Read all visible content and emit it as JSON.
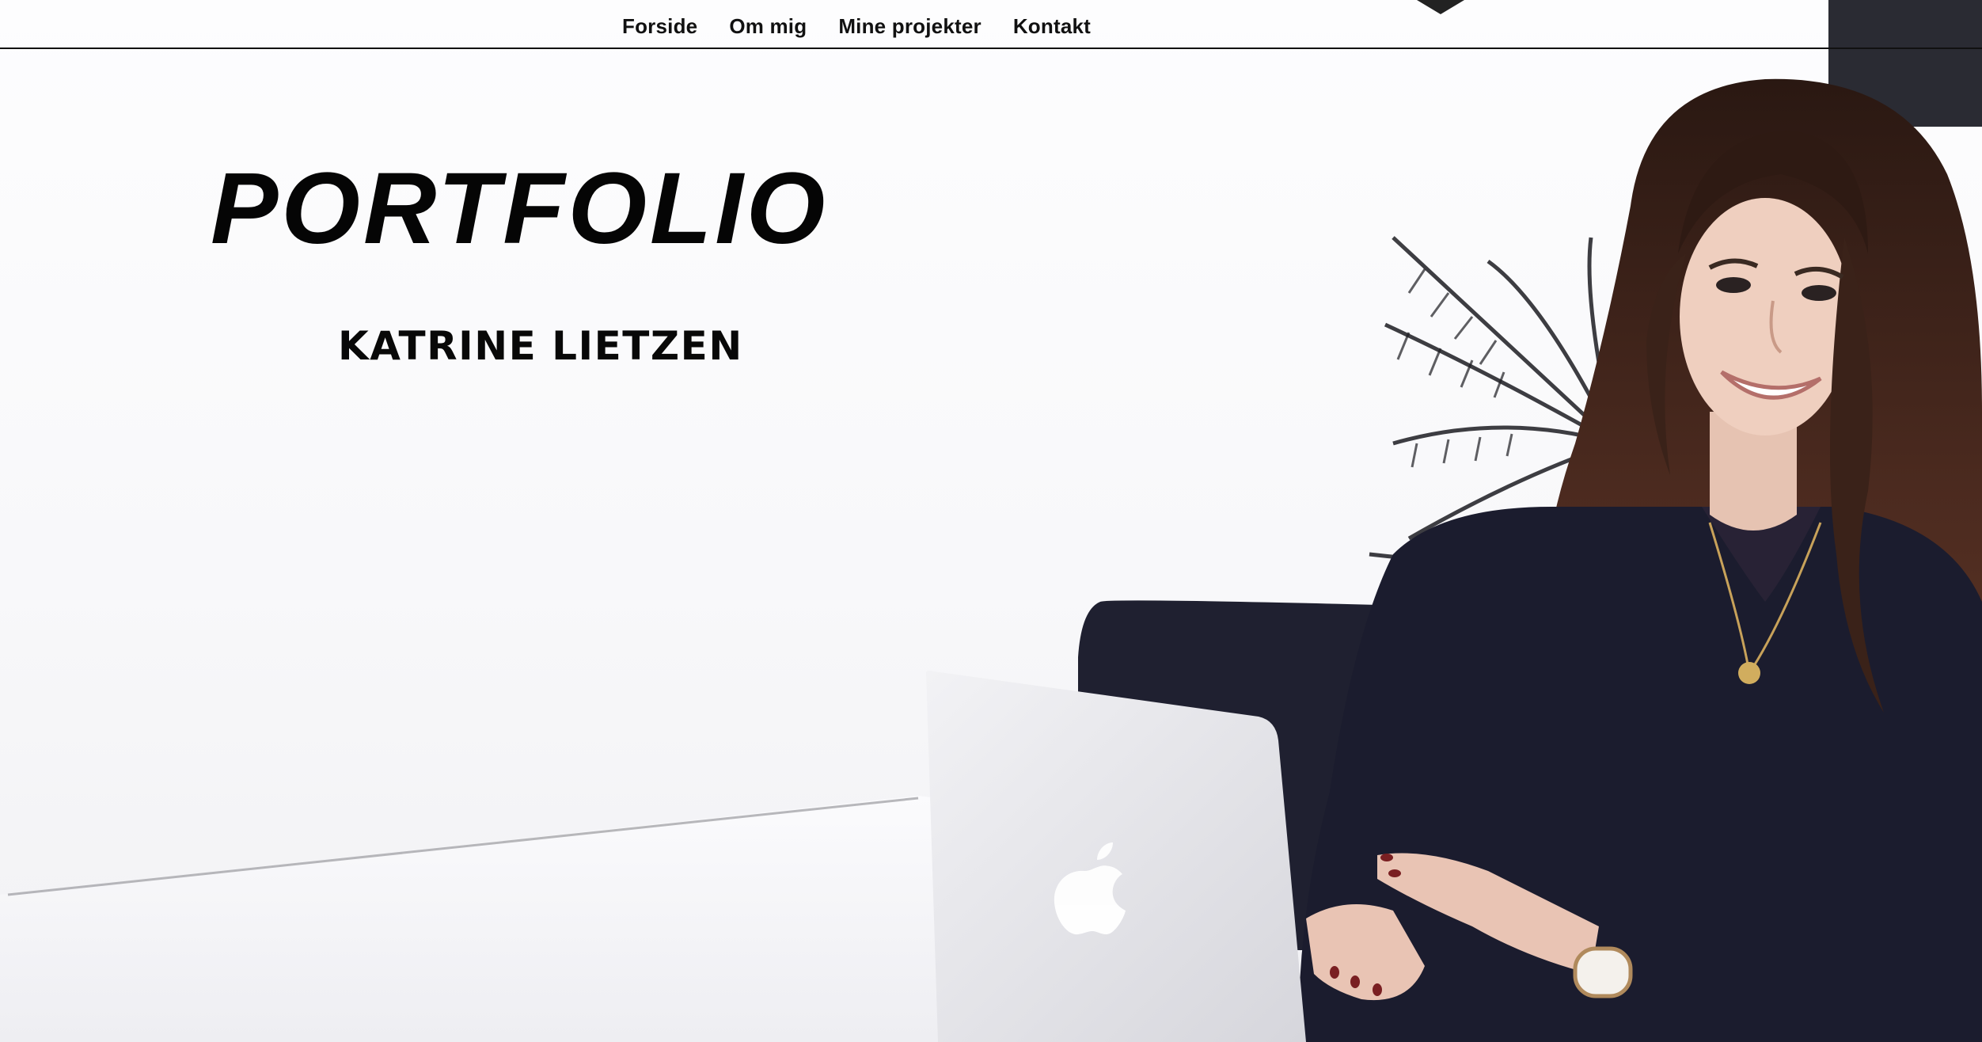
{
  "nav": {
    "items": [
      {
        "label": "Forside"
      },
      {
        "label": "Om mig"
      },
      {
        "label": "Mine projekter"
      },
      {
        "label": "Kontakt"
      }
    ]
  },
  "hero": {
    "title": "PORTFOLIO",
    "name": "KATRINE LIETZEN"
  },
  "colors": {
    "text": "#050505",
    "background": "#fdfdfe",
    "sweater": "#1b1c2e",
    "hair": "#5a3326",
    "laptop": "#e4e4e8"
  }
}
